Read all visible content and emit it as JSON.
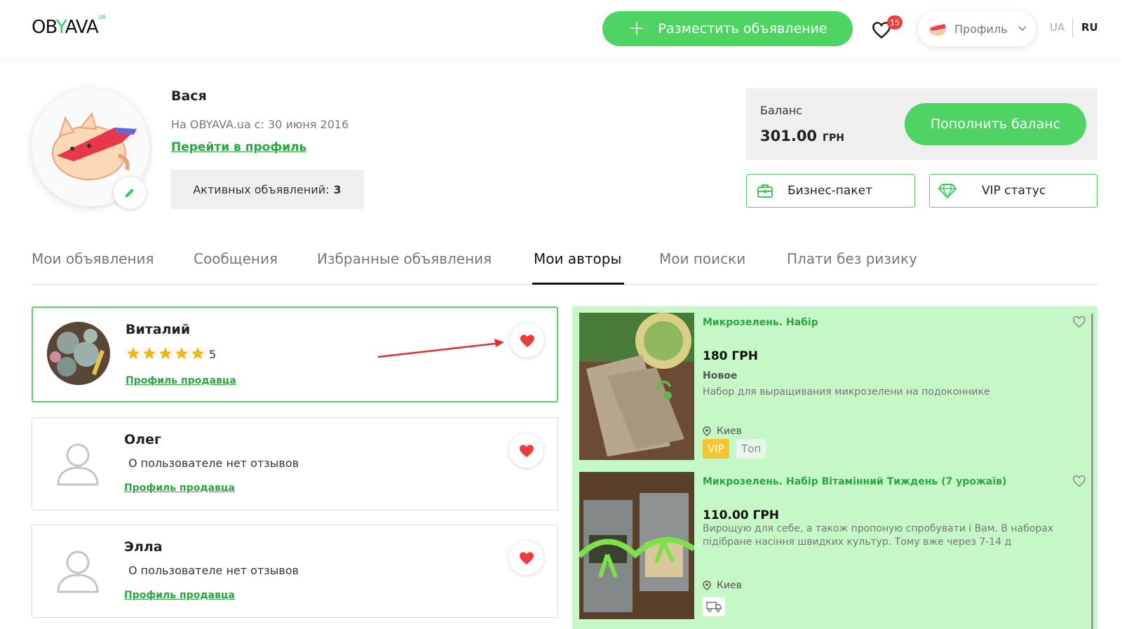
{
  "header": {
    "logo_text": "OBYAVA",
    "logo_suffix": "UA",
    "post_label": "Разместить объявление",
    "favorites_count": "15",
    "profile_label": "Профиль",
    "lang_ua": "UA",
    "lang_ru": "RU",
    "accent_color": "#4fd464"
  },
  "user": {
    "name": "Вася",
    "since": "На OBYAVA.ua с: 30 июня 2016",
    "profile_link": "Перейти в профиль",
    "active_ads_label": "Активных объявлений:",
    "active_ads_count": "3"
  },
  "balance": {
    "label": "Баланс",
    "amount": "301.00",
    "currency": "ГРН",
    "topup_label": "Пополнить баланс",
    "business_label": "Бизнес-пакет",
    "vip_label": "VIP статус"
  },
  "tabs": [
    {
      "label": "Мои объявления"
    },
    {
      "label": "Сообщения"
    },
    {
      "label": "Избранные объявления"
    },
    {
      "label": "Мои авторы",
      "active": true
    },
    {
      "label": "Мои поиски"
    },
    {
      "label": "Плати без ризику"
    }
  ],
  "authors": [
    {
      "name": "Виталий",
      "rating": 5,
      "rating_text": "5",
      "seller_link": "Профиль продавца",
      "selected": true
    },
    {
      "name": "Олег",
      "no_reviews": "О пользователе нет отзывов",
      "seller_link": "Профиль продавца"
    },
    {
      "name": "Элла",
      "no_reviews": "О пользователе нет отзывов",
      "seller_link": "Профиль продавца"
    }
  ],
  "listings": [
    {
      "title": "Микрозелень. Набір",
      "price": "180 ГРН",
      "condition": "Новое",
      "description": "Набор для выращивания микрозелени на подоконнике",
      "city": "Киев",
      "tags": [
        "VIP",
        "Топ"
      ]
    },
    {
      "title": "Микрозелень. Набір Вітамінний Тиждень (7 урожаїв)",
      "price": "110.00 ГРН",
      "description": "Вирощую для себе, а також пропоную спробувати і Вам. В наборах підібране насіння швидких культур. Тому вже через 7-14 д",
      "city": "Киев",
      "delivery_icon": "truck-icon"
    }
  ]
}
